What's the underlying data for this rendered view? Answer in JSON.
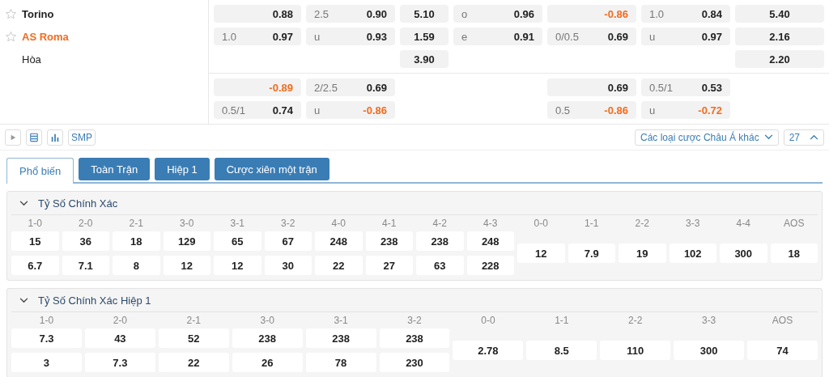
{
  "teams": [
    {
      "kind": "team",
      "name": "Torino",
      "highlighted": false
    },
    {
      "kind": "team",
      "name": "AS Roma",
      "highlighted": true
    },
    {
      "kind": "draw",
      "name": "Hòa",
      "highlighted": false
    }
  ],
  "odds_blocks": [
    {
      "rows": [
        [
          {
            "kind": "pair",
            "value": "0.88",
            "negative": false
          },
          {
            "kind": "pair",
            "line": "2.5",
            "value": "0.90",
            "negative": false
          },
          {
            "kind": "center",
            "value": "5.10",
            "negative": false
          },
          {
            "kind": "pair",
            "line": "o",
            "value": "0.96",
            "negative": false
          },
          {
            "kind": "pair",
            "value": "-0.86",
            "negative": true
          },
          {
            "kind": "pair",
            "line": "1.0",
            "value": "0.84",
            "negative": false
          },
          {
            "kind": "center",
            "value": "5.40",
            "negative": false
          }
        ],
        [
          {
            "kind": "pair",
            "line": "1.0",
            "value": "0.97",
            "negative": false
          },
          {
            "kind": "pair",
            "line": "u",
            "value": "0.93",
            "negative": false
          },
          {
            "kind": "center",
            "value": "1.59",
            "negative": false
          },
          {
            "kind": "pair",
            "line": "e",
            "value": "0.91",
            "negative": false
          },
          {
            "kind": "pair",
            "line": "0/0.5",
            "value": "0.69",
            "negative": false
          },
          {
            "kind": "pair",
            "line": "u",
            "value": "0.97",
            "negative": false
          },
          {
            "kind": "center",
            "value": "2.16",
            "negative": false
          }
        ],
        [
          {
            "kind": "empty"
          },
          {
            "kind": "empty"
          },
          {
            "kind": "center",
            "value": "3.90",
            "negative": false
          },
          {
            "kind": "empty"
          },
          {
            "kind": "empty"
          },
          {
            "kind": "empty"
          },
          {
            "kind": "center",
            "value": "2.20",
            "negative": false
          }
        ]
      ]
    },
    {
      "rows": [
        [
          {
            "kind": "pair",
            "value": "-0.89",
            "negative": true
          },
          {
            "kind": "pair",
            "line": "2/2.5",
            "value": "0.69",
            "negative": false
          },
          {
            "kind": "empty"
          },
          {
            "kind": "empty"
          },
          {
            "kind": "pair",
            "value": "0.69",
            "negative": false
          },
          {
            "kind": "pair",
            "line": "0.5/1",
            "value": "0.53",
            "negative": false
          },
          {
            "kind": "empty"
          }
        ],
        [
          {
            "kind": "pair",
            "line": "0.5/1",
            "value": "0.74",
            "negative": false
          },
          {
            "kind": "pair",
            "line": "u",
            "value": "-0.86",
            "negative": true
          },
          {
            "kind": "empty"
          },
          {
            "kind": "empty"
          },
          {
            "kind": "pair",
            "line": "0.5",
            "value": "-0.86",
            "negative": true
          },
          {
            "kind": "pair",
            "line": "u",
            "value": "-0.72",
            "negative": true
          },
          {
            "kind": "empty"
          }
        ]
      ]
    }
  ],
  "toolbar": {
    "smp": "SMP",
    "market_dropdown": "Các loại cược Châu Á khác",
    "count": "27"
  },
  "tabs": [
    {
      "label": "Phổ biến",
      "selected": true
    },
    {
      "label": "Toàn Trận",
      "selected": false
    },
    {
      "label": "Hiệp 1",
      "selected": false
    },
    {
      "label": "Cược xiên một trận",
      "selected": false
    }
  ],
  "sections": [
    {
      "title": "Tỷ Số Chính Xác",
      "expanded": true,
      "columns": [
        {
          "label": "1-0",
          "values": [
            "15",
            "6.7"
          ]
        },
        {
          "label": "2-0",
          "values": [
            "36",
            "7.1"
          ]
        },
        {
          "label": "2-1",
          "values": [
            "18",
            "8"
          ]
        },
        {
          "label": "3-0",
          "values": [
            "129",
            "12"
          ]
        },
        {
          "label": "3-1",
          "values": [
            "65",
            "12"
          ]
        },
        {
          "label": "3-2",
          "values": [
            "67",
            "30"
          ]
        },
        {
          "label": "4-0",
          "values": [
            "248",
            "22"
          ]
        },
        {
          "label": "4-1",
          "values": [
            "238",
            "27"
          ]
        },
        {
          "label": "4-2",
          "values": [
            "238",
            "63"
          ]
        },
        {
          "label": "4-3",
          "values": [
            "248",
            "228"
          ]
        },
        {
          "label": "0-0",
          "values": [
            "12"
          ]
        },
        {
          "label": "1-1",
          "values": [
            "7.9"
          ]
        },
        {
          "label": "2-2",
          "values": [
            "19"
          ]
        },
        {
          "label": "3-3",
          "values": [
            "102"
          ]
        },
        {
          "label": "4-4",
          "values": [
            "300"
          ]
        },
        {
          "label": "AOS",
          "values": [
            "18"
          ]
        }
      ]
    },
    {
      "title": "Tỷ Số Chính Xác Hiệp 1",
      "expanded": true,
      "columns": [
        {
          "label": "1-0",
          "values": [
            "7.3",
            "3"
          ]
        },
        {
          "label": "2-0",
          "values": [
            "43",
            "7.3"
          ]
        },
        {
          "label": "2-1",
          "values": [
            "52",
            "22"
          ]
        },
        {
          "label": "3-0",
          "values": [
            "238",
            "26"
          ]
        },
        {
          "label": "3-1",
          "values": [
            "238",
            "78"
          ]
        },
        {
          "label": "3-2",
          "values": [
            "238",
            "230"
          ]
        },
        {
          "label": "0-0",
          "values": [
            "2.78"
          ]
        },
        {
          "label": "1-1",
          "values": [
            "8.5"
          ]
        },
        {
          "label": "2-2",
          "values": [
            "110"
          ]
        },
        {
          "label": "3-3",
          "values": [
            "300"
          ]
        },
        {
          "label": "AOS",
          "values": [
            "74"
          ]
        }
      ]
    }
  ]
}
